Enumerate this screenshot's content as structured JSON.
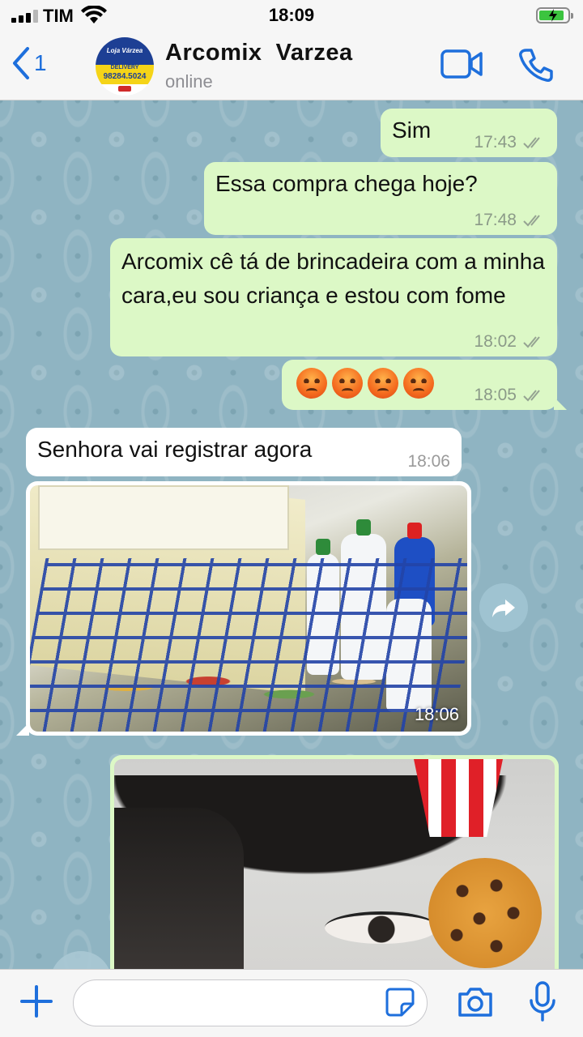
{
  "status_bar": {
    "carrier": "TIM",
    "time": "18:09"
  },
  "header": {
    "back_count": "1",
    "contact_name": "Arcomix  Varzea",
    "contact_status": "online",
    "avatar": {
      "line1": "Loja Várzea",
      "line2": "DELIVERY",
      "line3": "98284.5024"
    }
  },
  "messages": [
    {
      "dir": "out",
      "text": "Sim",
      "time": "17:43"
    },
    {
      "dir": "out",
      "text": "Essa compra chega hoje?",
      "time": "17:48"
    },
    {
      "dir": "out",
      "text": "Arcomix cê tá de brincadeira com a minha cara,eu sou criança e estou com fome",
      "time": "18:02"
    },
    {
      "dir": "out",
      "text": "😡😡😡😡",
      "time": "18:05"
    },
    {
      "dir": "in",
      "text": "Senhora vai registrar agora",
      "time": "18:06"
    },
    {
      "dir": "in",
      "type": "image",
      "time": "18:06"
    }
  ],
  "input": {
    "placeholder": ""
  }
}
